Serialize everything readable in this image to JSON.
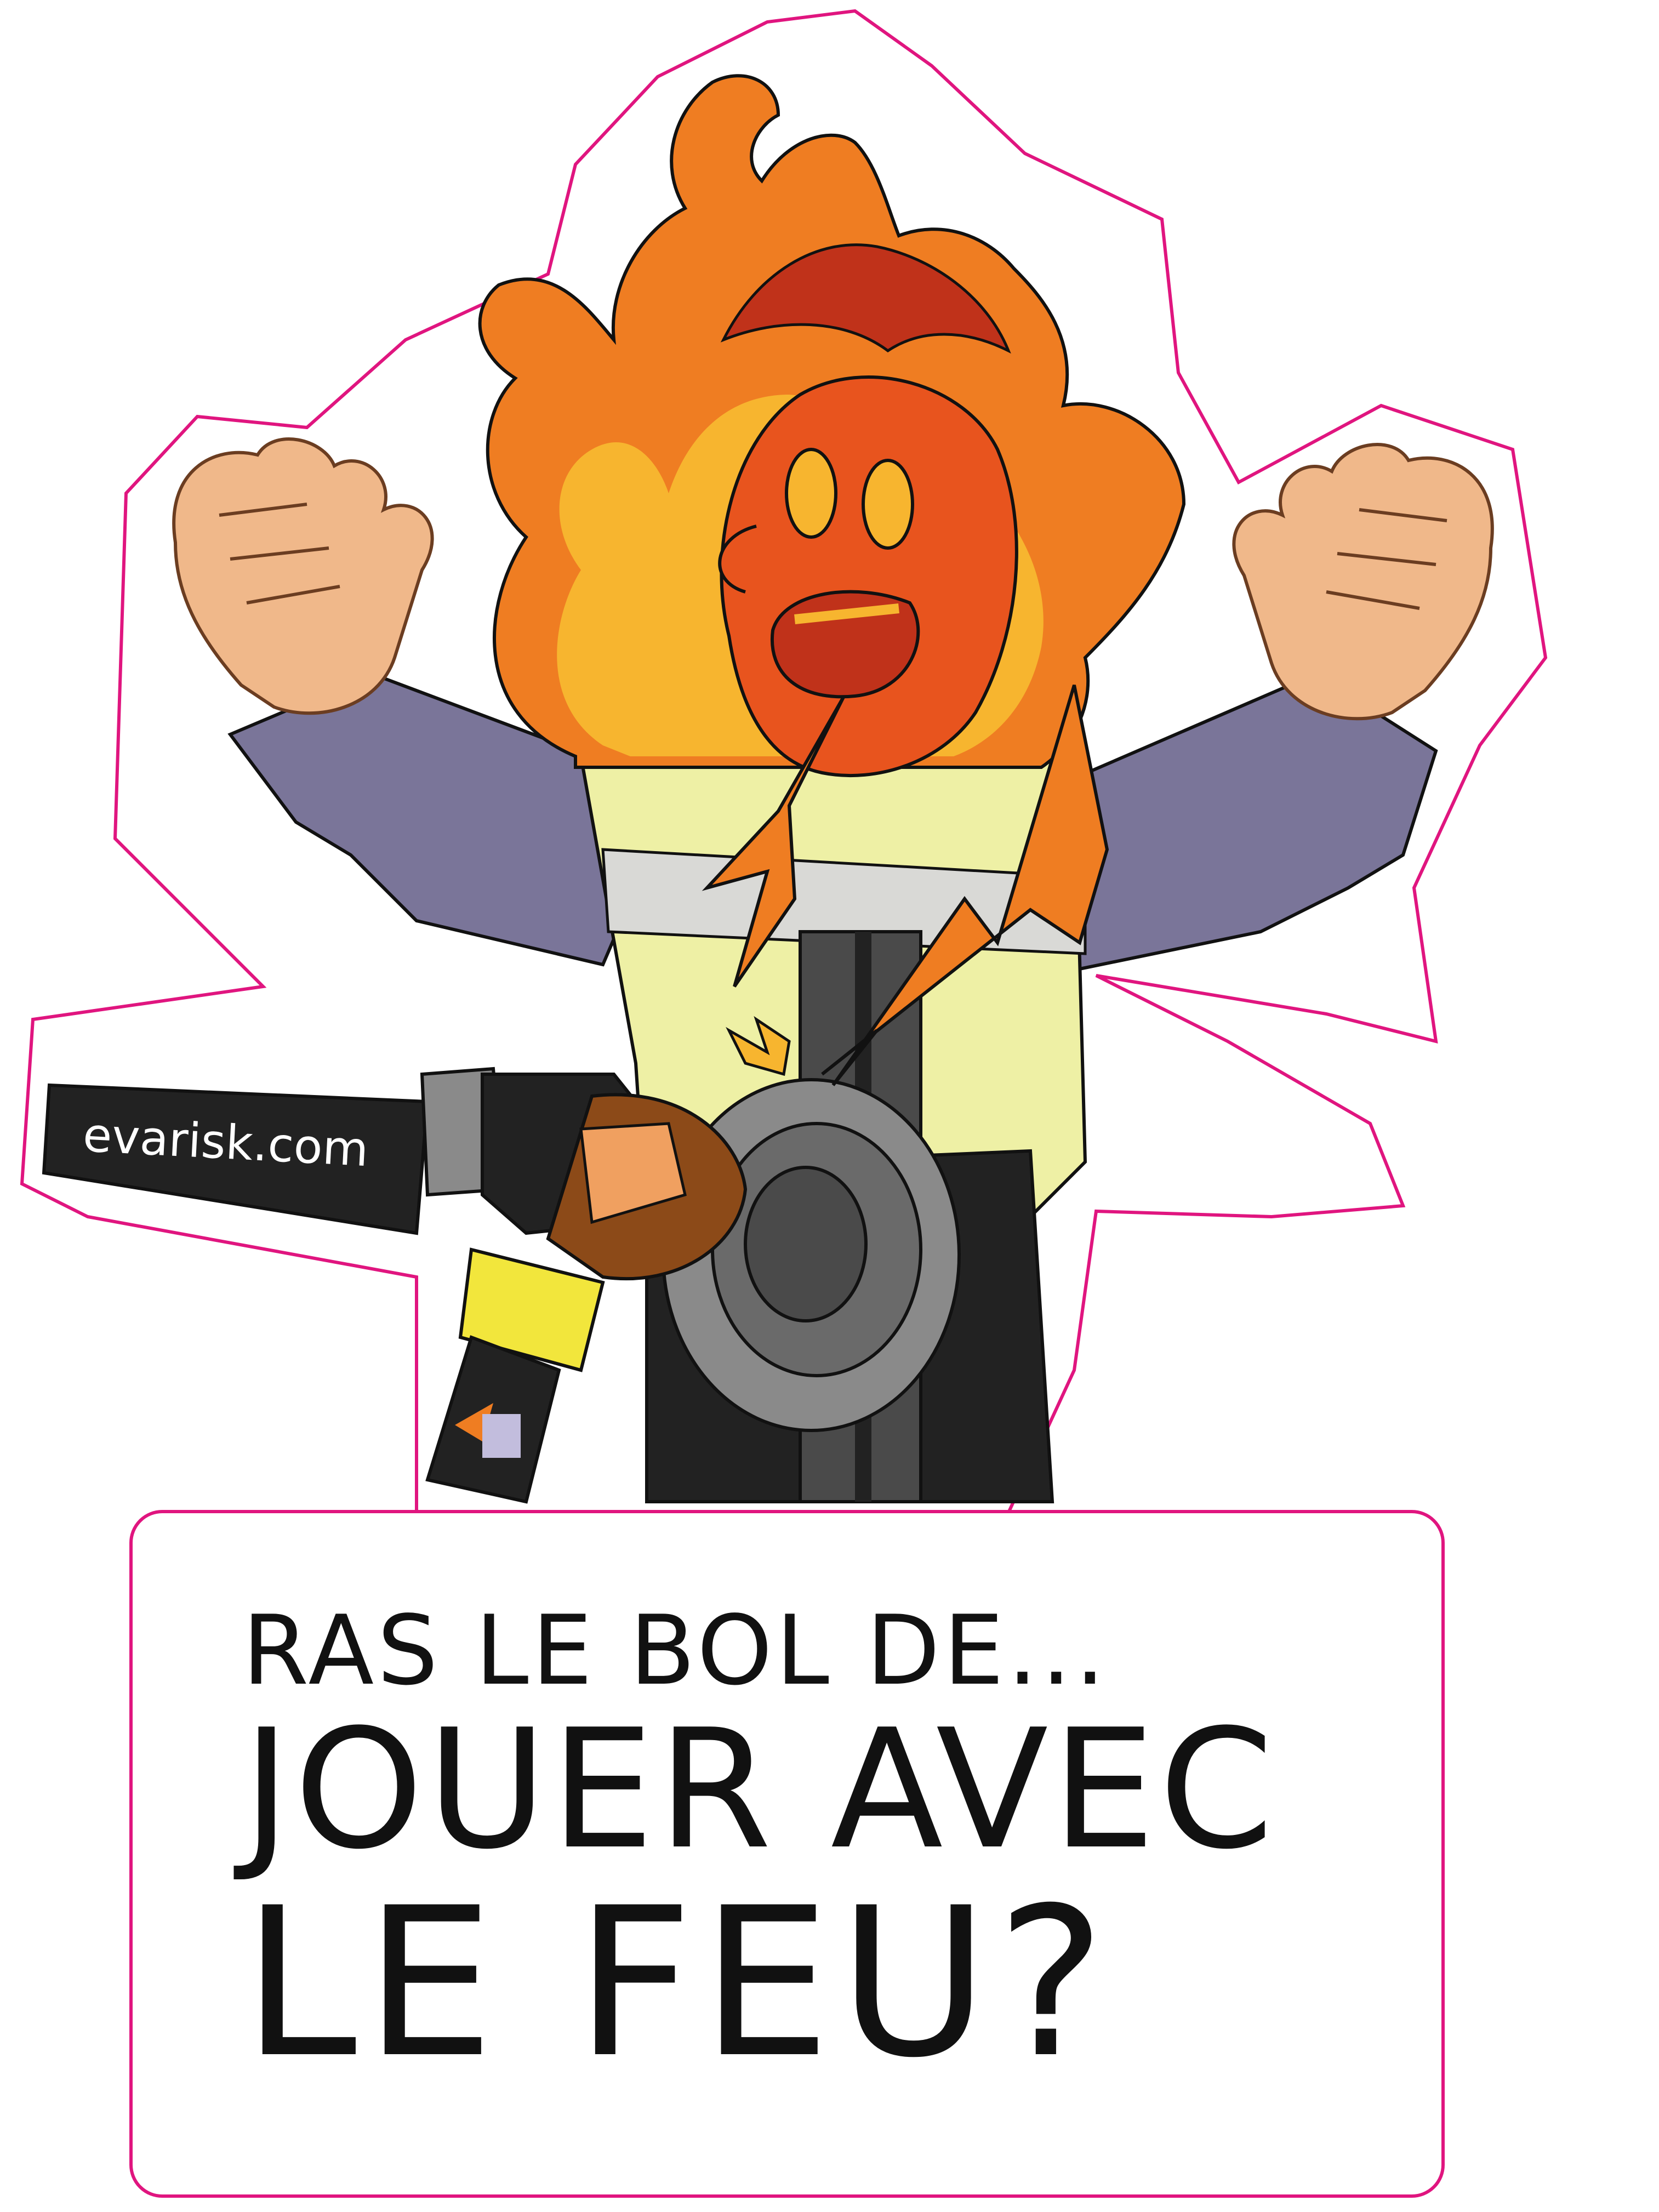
{
  "brand": {
    "text": "evarisk.com"
  },
  "caption": {
    "line1": "RAS LE BOL DE...",
    "line2": "JOUER AVEC",
    "line3": "LE FEU?"
  },
  "colors": {
    "cut_line": "#e0157f",
    "flame_outer": "#ef7d22",
    "flame_inner": "#f7b52f",
    "flame_dark": "#c0321a",
    "face": "#e8541e",
    "skin": "#f0b88a",
    "jacket": "#7a7599",
    "vest": "#eef0a5",
    "grinder_body": "#8c4a18",
    "grinder_tool": "#222222",
    "disc": "#8a8a8a"
  },
  "icons": [
    "flame-icon",
    "angle-grinder-icon",
    "spark-icon"
  ]
}
